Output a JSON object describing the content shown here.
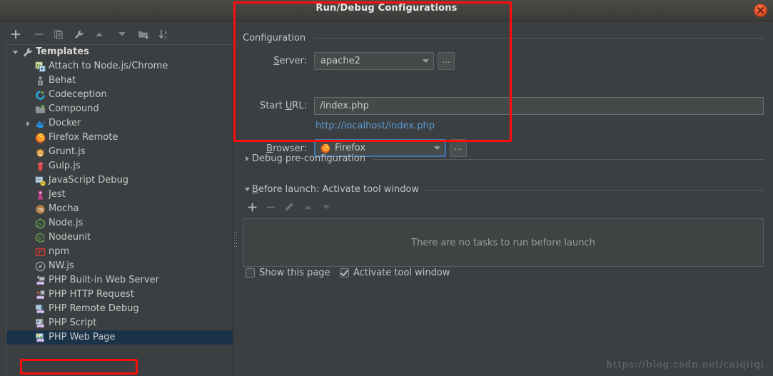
{
  "dialog": {
    "title": "Run/Debug Configurations",
    "close_icon": "close-icon"
  },
  "sidebar": {
    "toolbar": [
      {
        "name": "add-configuration-button",
        "icon": "plus-icon",
        "enabled": true
      },
      {
        "name": "remove-configuration-button",
        "icon": "minus-icon",
        "enabled": false
      },
      {
        "name": "copy-configuration-button",
        "icon": "copy-icon",
        "enabled": false
      },
      {
        "name": "edit-templates-button",
        "icon": "wrench-icon",
        "enabled": false
      },
      {
        "name": "move-up-button",
        "icon": "arrow-up-icon",
        "enabled": false
      },
      {
        "name": "move-down-button",
        "icon": "arrow-down-icon",
        "enabled": false
      },
      {
        "name": "new-folder-button",
        "icon": "folder-add-icon",
        "enabled": false
      },
      {
        "name": "sort-alphabetically-button",
        "icon": "sort-az-icon",
        "enabled": false
      }
    ],
    "tree": [
      {
        "label": "Templates",
        "icon": "wrench-icon",
        "depth": 0,
        "twist": "expanded",
        "selected": false
      },
      {
        "label": "Attach to Node.js/Chrome",
        "icon": "js-attach-icon",
        "depth": 1,
        "twist": "none",
        "selected": false
      },
      {
        "label": "Behat",
        "icon": "behat-icon",
        "depth": 1,
        "twist": "none",
        "selected": false
      },
      {
        "label": "Codeception",
        "icon": "codeception-icon",
        "depth": 1,
        "twist": "none",
        "selected": false
      },
      {
        "label": "Compound",
        "icon": "compound-folder-icon",
        "depth": 1,
        "twist": "none",
        "selected": false
      },
      {
        "label": "Docker",
        "icon": "docker-icon",
        "depth": 1,
        "twist": "collapsed",
        "selected": false
      },
      {
        "label": "Firefox Remote",
        "icon": "firefox-icon",
        "depth": 1,
        "twist": "none",
        "selected": false
      },
      {
        "label": "Grunt.js",
        "icon": "grunt-icon",
        "depth": 1,
        "twist": "none",
        "selected": false
      },
      {
        "label": "Gulp.js",
        "icon": "gulp-icon",
        "depth": 1,
        "twist": "none",
        "selected": false
      },
      {
        "label": "JavaScript Debug",
        "icon": "js-debug-icon",
        "depth": 1,
        "twist": "none",
        "selected": false
      },
      {
        "label": "Jest",
        "icon": "jest-icon",
        "depth": 1,
        "twist": "none",
        "selected": false
      },
      {
        "label": "Mocha",
        "icon": "mocha-icon",
        "depth": 1,
        "twist": "none",
        "selected": false
      },
      {
        "label": "Node.js",
        "icon": "nodejs-icon",
        "depth": 1,
        "twist": "none",
        "selected": false
      },
      {
        "label": "Nodeunit",
        "icon": "nodeunit-icon",
        "depth": 1,
        "twist": "none",
        "selected": false
      },
      {
        "label": "npm",
        "icon": "npm-icon",
        "depth": 1,
        "twist": "none",
        "selected": false
      },
      {
        "label": "NW.js",
        "icon": "nwjs-icon",
        "depth": 1,
        "twist": "none",
        "selected": false
      },
      {
        "label": "PHP Built-in Web Server",
        "icon": "php-server-icon",
        "depth": 1,
        "twist": "none",
        "selected": false
      },
      {
        "label": "PHP HTTP Request",
        "icon": "php-http-icon",
        "depth": 1,
        "twist": "none",
        "selected": false
      },
      {
        "label": "PHP Remote Debug",
        "icon": "php-remote-icon",
        "depth": 1,
        "twist": "none",
        "selected": false
      },
      {
        "label": "PHP Script",
        "icon": "php-script-icon",
        "depth": 1,
        "twist": "none",
        "selected": false
      },
      {
        "label": "PHP Web Page",
        "icon": "php-web-page-icon",
        "depth": 1,
        "twist": "none",
        "selected": true
      }
    ]
  },
  "configuration": {
    "group_label": "Configuration",
    "server": {
      "label": "Server:",
      "label_mnemonic": "S",
      "value": "apache2",
      "browse_label": "...",
      "focused": false
    },
    "start_url": {
      "label": "Start URL:",
      "label_mnemonic": "U",
      "value": "/index.php",
      "placeholder": "/index.php"
    },
    "resolved_url": "http://localhost/index.php",
    "browser": {
      "label": "Browser:",
      "label_mnemonic": "B",
      "value": "Firefox",
      "icon": "firefox-icon",
      "browse_label": "...",
      "focused": true
    }
  },
  "sections": {
    "debug_pre_configuration": {
      "label": "Debug pre-configuration",
      "expanded": false
    },
    "before_launch": {
      "label": "Before launch: Activate tool window",
      "label_mnemonic": "B",
      "expanded": true
    }
  },
  "before_launch": {
    "toolbar": [
      {
        "name": "add-task-button",
        "icon": "plus-icon",
        "enabled": true
      },
      {
        "name": "remove-task-button",
        "icon": "minus-icon",
        "enabled": false
      },
      {
        "name": "edit-task-button",
        "icon": "pencil-icon",
        "enabled": false
      },
      {
        "name": "move-task-up-button",
        "icon": "arrow-up-icon",
        "enabled": false
      },
      {
        "name": "move-task-down-button",
        "icon": "arrow-down-icon",
        "enabled": false
      }
    ],
    "empty_text": "There are no tasks to run before launch",
    "checkboxes": [
      {
        "label": "Show this page",
        "checked": false
      },
      {
        "label": "Activate tool window",
        "checked": true
      }
    ]
  },
  "watermark": "https://blog.csdn.net/caiqiiqi",
  "colors": {
    "window_bg": "#3c3f41",
    "selection_bg": "#1b3349",
    "link": "#5b9bd5",
    "focus_border": "#3d7bb5",
    "annotation_red": "#ff0d0d",
    "text": "#c0c3c4"
  }
}
